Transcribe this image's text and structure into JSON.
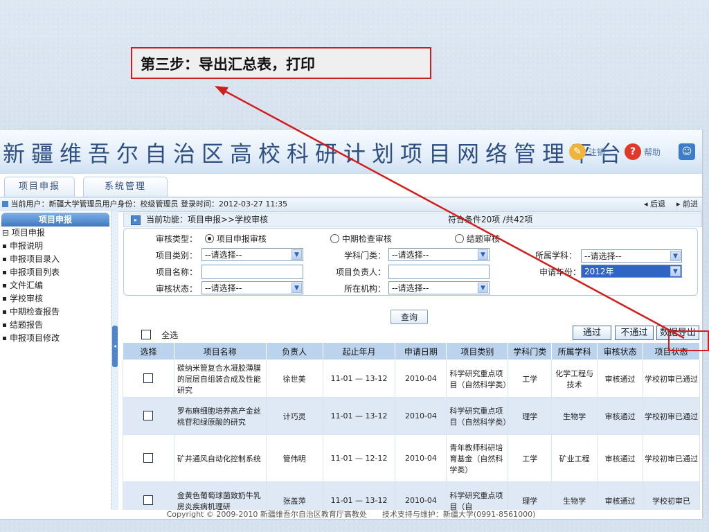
{
  "callout": {
    "text": "第三步：导出汇总表，打印"
  },
  "app": {
    "title": "新疆维吾尔自治区高校科研计划项目网络管理平台",
    "header_buttons": {
      "logout": "注销",
      "help": "帮助"
    }
  },
  "menu": {
    "tabs": [
      "项目申报",
      "系统管理"
    ]
  },
  "userbar": {
    "user_label": "当前用户：新疆大学管理员",
    "role_label": "用户身份：校级管理员",
    "login_label": "登录时间：2012-03-27 11:35",
    "back": "后退",
    "forward": "前进"
  },
  "sidebar": {
    "header": "项目申报",
    "root": "项目申报",
    "items": [
      "申报说明",
      "申报项目录入",
      "申报项目列表",
      "文件汇编",
      "学校审核",
      "中期检查报告",
      "结题报告",
      "申报项目修改"
    ]
  },
  "funcbar": {
    "label": "当前功能：项目申报>>学校审核",
    "summary": "符合条件20项 /共42项"
  },
  "filter": {
    "audit_type_label": "审核类型：",
    "audit_types": [
      "项目申报审核",
      "中期检查审核",
      "结题审核"
    ],
    "category_label": "项目类别：",
    "category_value": "--请选择--",
    "discipline_label": "学科门类：",
    "discipline_value": "--请选择--",
    "subject_label": "所属学科：",
    "subject_value": "--请选择--",
    "name_label": "项目名称：",
    "leader_label": "项目负责人：",
    "year_label": "申请年份：",
    "year_value": "2012年",
    "status_label": "审核状态：",
    "status_value": "--请选择--",
    "org_label": "所在机构：",
    "org_value": "--请选择--",
    "query_button": "查询"
  },
  "actions": {
    "select_all": "全选",
    "pass": "通过",
    "reject": "不通过",
    "export": "数据导出"
  },
  "table": {
    "headers": [
      "选择",
      "项目名称",
      "负责人",
      "起止年月",
      "申请日期",
      "项目类别",
      "学科门类",
      "所属学科",
      "审核状态",
      "项目状态"
    ],
    "rows": [
      [
        "",
        "碳纳米管复合水凝胶薄膜的层层自组装合成及性能研究",
        "徐世美",
        "11-01 — 13-12",
        "2010-04",
        "科学研究重点项目（自然科学类）",
        "工学",
        "化学工程与技术",
        "审核通过",
        "学校初审已通过"
      ],
      [
        "",
        "罗布麻细胞培养高产金丝桃苷和绿原酸的研究",
        "计巧灵",
        "11-01 — 13-12",
        "2010-04",
        "科学研究重点项目（自然科学类）",
        "理学",
        "生物学",
        "审核通过",
        "学校初审已通过"
      ],
      [
        "",
        "矿井通风自动化控制系统",
        "管伟明",
        "11-01 — 12-12",
        "2010-04",
        "青年教师科研培育基金（自然科学类）",
        "工学",
        "矿业工程",
        "审核通过",
        "学校初审已通过"
      ],
      [
        "",
        "金黄色葡萄球菌致奶牛乳房炎疾病机理研",
        "张盖萍",
        "11-01 — 13-12",
        "2010-04",
        "科学研究重点项目（自",
        "理学",
        "生物学",
        "审核通过",
        "学校初审已"
      ]
    ]
  },
  "footer": {
    "text": "Copyright © 2009-2010 新疆维吾尔自治区教育厅高教处　　技术支持与维护：新疆大学(0991-8561000)"
  },
  "colors": {
    "accent_red": "#d21d1d",
    "header_blue": "#bcd3ee",
    "title_blue": "#2f4f82"
  }
}
